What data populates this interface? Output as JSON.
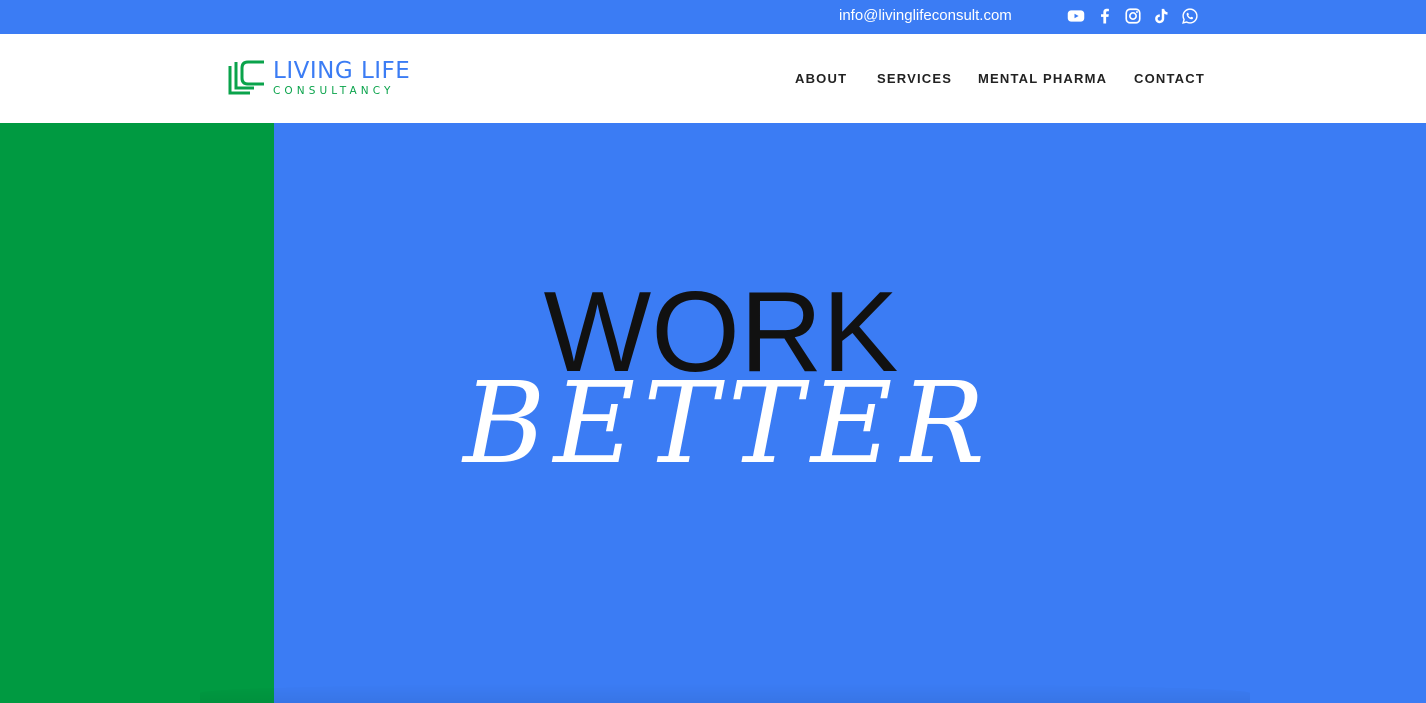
{
  "topbar": {
    "email": "info@livinglifeconsult.com",
    "social": [
      {
        "name": "youtube-icon"
      },
      {
        "name": "facebook-icon"
      },
      {
        "name": "instagram-icon"
      },
      {
        "name": "tiktok-icon"
      },
      {
        "name": "whatsapp-icon"
      }
    ]
  },
  "header": {
    "logo": {
      "title": "LIVING LIFE",
      "subtitle": "CONSULTANCY"
    },
    "nav": [
      {
        "label": "ABOUT"
      },
      {
        "label": "SERVICES"
      },
      {
        "label": "MENTAL PHARMA"
      },
      {
        "label": "CONTACT"
      }
    ]
  },
  "hero": {
    "line1": "WORK",
    "line2": "BETTER"
  },
  "colors": {
    "blue": "#3b7cf4",
    "green": "#009a41",
    "logo_green": "#0aa34b",
    "nav_text": "#222222"
  }
}
